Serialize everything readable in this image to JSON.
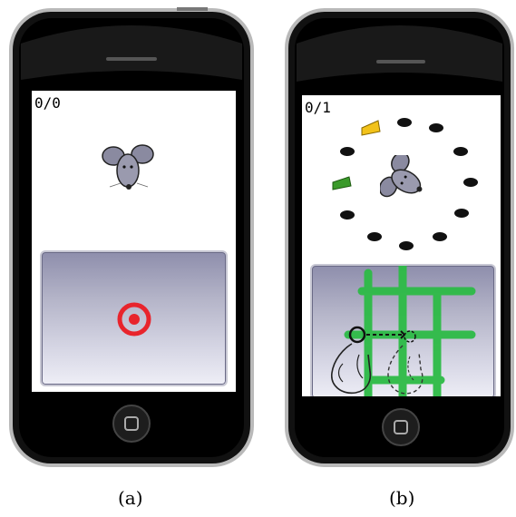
{
  "panels": [
    {
      "caption": "(a)",
      "score": "0/0"
    },
    {
      "caption": "(b)",
      "score": "0/1"
    }
  ],
  "icons": {
    "mouse": "mouse-icon",
    "target": "target-icon",
    "cheese": "cheese-icon",
    "food_pellet": "food-pellet-icon",
    "hand_gesture": "hand-swipe-icon",
    "home_button": "home-button"
  },
  "colors": {
    "target": "#e8242c",
    "grid_overlay": "#2dbb46",
    "cheese_yellow": "#f2c21a",
    "cheese_green": "#3a9a2a"
  }
}
